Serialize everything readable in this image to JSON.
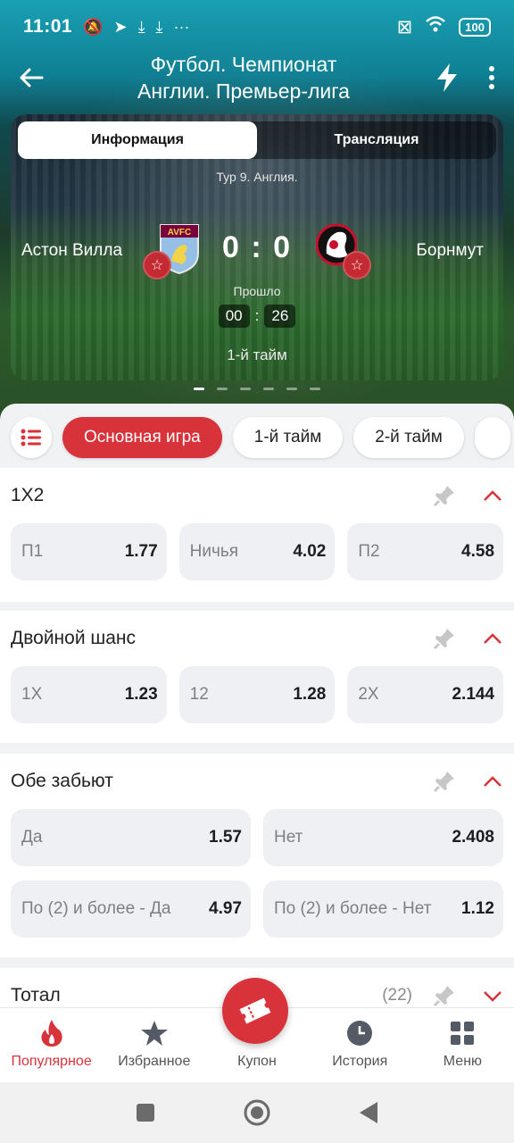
{
  "status_bar": {
    "time": "11:01",
    "battery": "100"
  },
  "app_bar": {
    "title_line1": "Футбол. Чемпионат",
    "title_line2": "Англии. Премьер-лига"
  },
  "match": {
    "tabs": [
      {
        "label": "Информация",
        "active": true
      },
      {
        "label": "Трансляция",
        "active": false
      }
    ],
    "round": "Тур 9. Англия.",
    "home_team": "Астон Вилла",
    "away_team": "Борнмут",
    "home_crest_text": "AVFC",
    "score": "0 : 0",
    "elapsed_label": "Прошло",
    "timer_min": "00",
    "timer_sep": ":",
    "timer_sec": "26",
    "period": "1-й тайм"
  },
  "filters": {
    "chips": [
      "Основная игра",
      "1-й тайм",
      "2-й тайм"
    ]
  },
  "markets": [
    {
      "title": "1X2",
      "rows": [
        [
          {
            "label": "П1",
            "value": "1.77"
          },
          {
            "label": "Ничья",
            "value": "4.02"
          },
          {
            "label": "П2",
            "value": "4.58"
          }
        ]
      ]
    },
    {
      "title": "Двойной шанс",
      "rows": [
        [
          {
            "label": "1X",
            "value": "1.23"
          },
          {
            "label": "12",
            "value": "1.28"
          },
          {
            "label": "2X",
            "value": "2.144"
          }
        ]
      ]
    },
    {
      "title": "Обе забьют",
      "rows": [
        [
          {
            "label": "Да",
            "value": "1.57"
          },
          {
            "label": "Нет",
            "value": "2.408"
          }
        ],
        [
          {
            "label": "По (2) и более - Да",
            "value": "4.97"
          },
          {
            "label": "По (2) и более - Нет",
            "value": "1.12"
          }
        ]
      ]
    },
    {
      "title": "Тотал",
      "count": "(22)"
    }
  ],
  "bottom_nav": {
    "popular": "Популярное",
    "favorites": "Избранное",
    "coupon": "Купон",
    "history": "История",
    "menu": "Меню"
  },
  "colors": {
    "accent": "#d8333a",
    "odd_bg": "#eef0f3"
  }
}
